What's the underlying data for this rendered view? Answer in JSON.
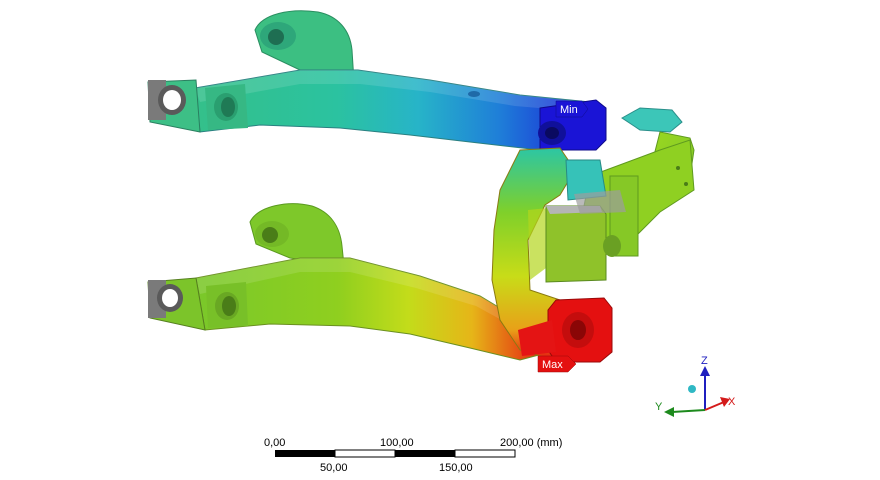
{
  "probes": {
    "min_label": "Min",
    "max_label": "Max",
    "min_color": "#1a14d6",
    "max_color": "#e41010"
  },
  "triad": {
    "z_label": "Z",
    "y_label": "Y",
    "x_label": "X",
    "z_color": "#1f1fbf",
    "y_color": "#1d8a1d",
    "x_color": "#d41b1b"
  },
  "scale_bar": {
    "top_labels": [
      "0,00",
      "100,00",
      "200,00 (mm)"
    ],
    "bottom_labels": [
      "50,00",
      "150,00"
    ]
  },
  "contour_colors": [
    "#1a14d6",
    "#1aa8d8",
    "#2bc9a8",
    "#3bbf7a",
    "#7ed321",
    "#c9e01a",
    "#e8d418",
    "#e8a018",
    "#e41010"
  ],
  "icons": {
    "part": "suspension-arm-model",
    "triad": "coordinate-triad-icon"
  }
}
